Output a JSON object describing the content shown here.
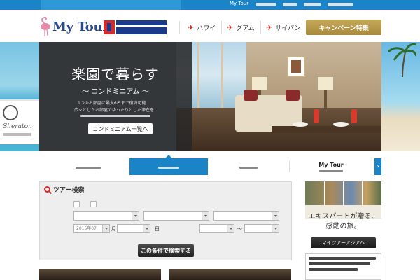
{
  "topbar": {
    "tagline": "",
    "links": [
      "My Tour",
      "",
      "",
      "",
      ""
    ]
  },
  "header": {
    "logo_text": "My Tour",
    "partner_logo": "",
    "nav": [
      {
        "label": "ハワイ",
        "icon": "airplane-icon"
      },
      {
        "label": "グアム",
        "icon": "airplane-icon"
      },
      {
        "label": "サイパン",
        "icon": "airplane-icon"
      }
    ],
    "campaign_label": "キャンペーン特集"
  },
  "hero": {
    "title": "楽園で暮らす",
    "subtitle": "〜 コンドミニアム 〜",
    "description_lines": [
      "1つのお部屋に最大6名まで宿泊可能",
      "広々としたお部屋でゆったりとした滞在を",
      ""
    ],
    "cta_label": "コンドミニアム一覧へ",
    "left_brand": "Sheraton"
  },
  "tabs": [
    {
      "label": "",
      "sub": "",
      "active": false
    },
    {
      "label": "",
      "sub": "",
      "active": true
    },
    {
      "label": "",
      "sub": "",
      "active": false
    },
    {
      "label": "My Tour",
      "sub": "",
      "active": false
    }
  ],
  "search": {
    "title": "ツアー検索",
    "rows": {
      "type_options": [
        "",
        ""
      ],
      "destination_placeholders": [
        "",
        "",
        ""
      ],
      "date_value": "2015年07",
      "date_placeholder": "",
      "budget_label": "",
      "budget_placeholders": [
        "",
        ""
      ]
    },
    "submit_label": "この条件で検索する"
  },
  "features": [
    {
      "label": ""
    },
    {
      "label": ""
    }
  ],
  "ad": {
    "caption": "",
    "title_lines": [
      "エキスパートが贈る、",
      "感動の旅。"
    ],
    "button_label": "マイツアーアジアへ"
  },
  "colors": {
    "brand_blue": "#1a84c6",
    "accent_red": "#d62a2a",
    "campaign_gold": "#b8993f"
  }
}
